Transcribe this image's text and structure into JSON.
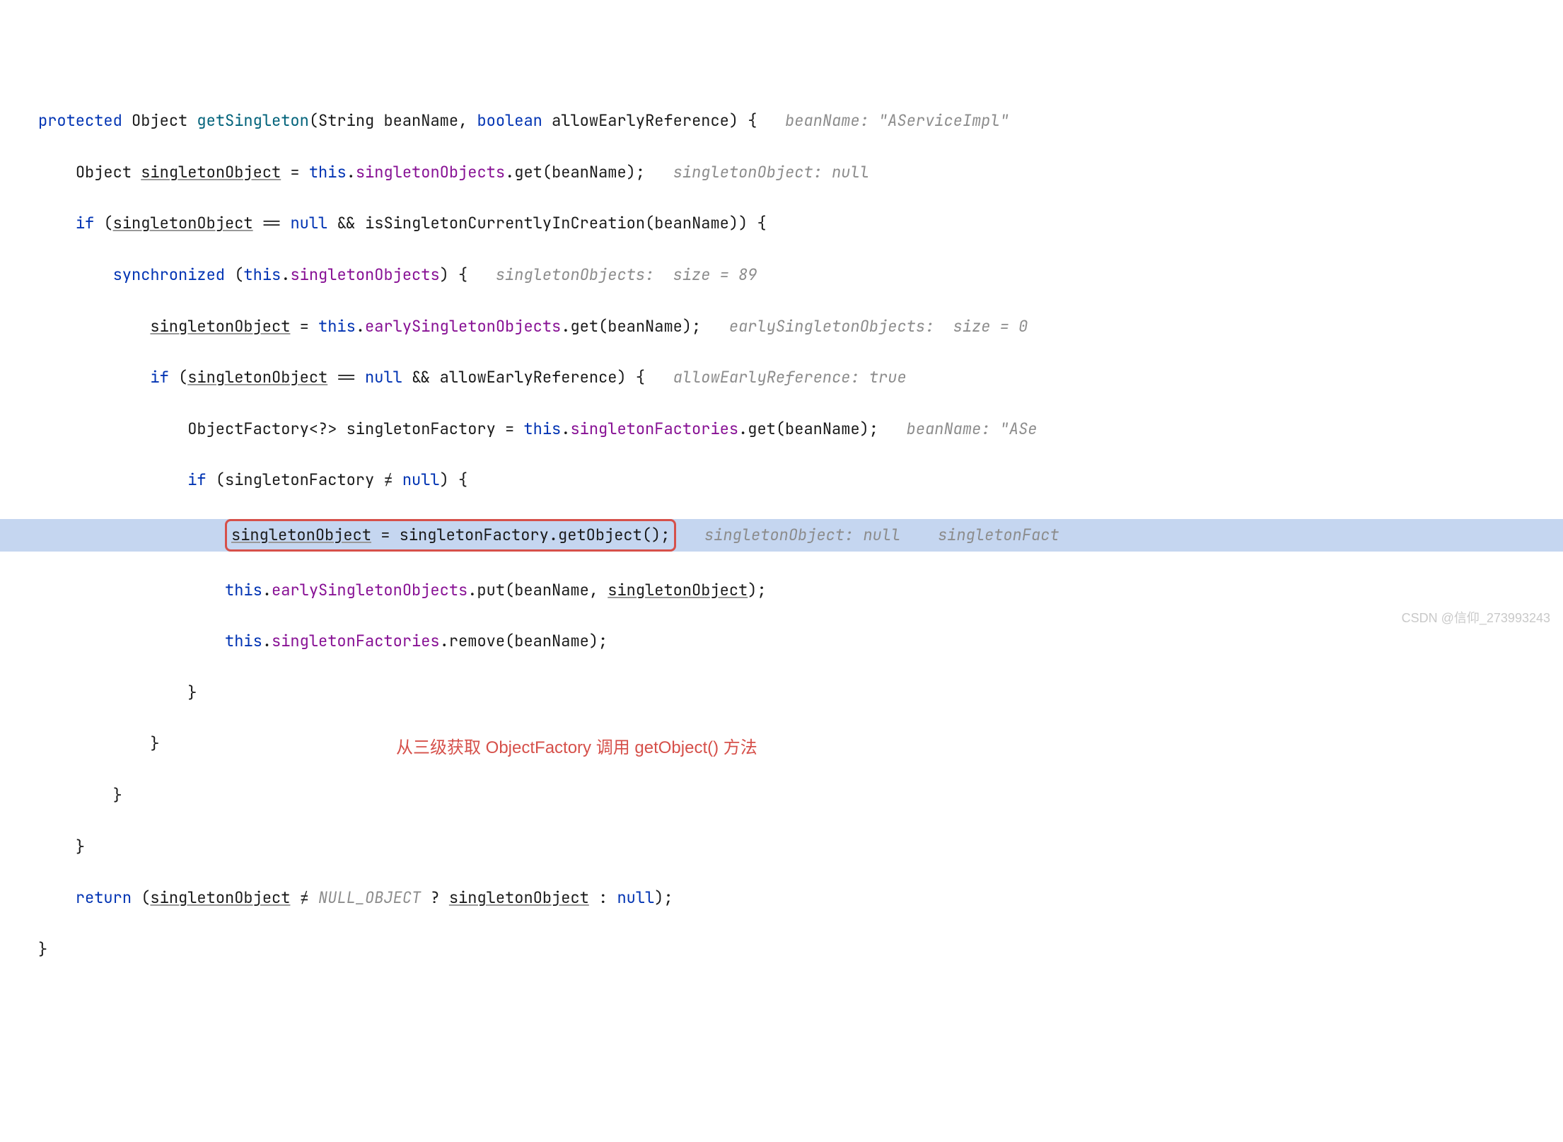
{
  "code": {
    "l1": {
      "kw_protected": "protected",
      "type_object": "Object",
      "method": "getSingleton",
      "param1_type": "String",
      "param1_name": "beanName",
      "param2_type": "boolean",
      "param2_name": "allowEarlyReference",
      "brace": ") {",
      "hint": "beanName: \"AServiceImpl\""
    },
    "l2": {
      "type_object": "Object",
      "var": "singletonObject",
      "eq": " = ",
      "this": "this",
      "field": "singletonObjects",
      "call": ".get(beanName);",
      "hint": "singletonObject: null"
    },
    "l3": {
      "kw_if": "if",
      "open": " (",
      "var": "singletonObject",
      "eqop": " == ",
      "null": "null",
      "and": " && ",
      "call": "isSingletonCurrentlyInCreation(beanName)) {"
    },
    "l4": {
      "kw_sync": "synchronized",
      "open": " (",
      "this": "this",
      "field": "singletonObjects",
      "close": ") {",
      "hint": "singletonObjects:  size = 89"
    },
    "l5": {
      "var": "singletonObject",
      "eq": " = ",
      "this": "this",
      "field": "earlySingletonObjects",
      "call": ".get(beanName);",
      "hint": "earlySingletonObjects:  size = 0"
    },
    "l6": {
      "kw_if": "if",
      "open": " (",
      "var": "singletonObject",
      "eqop": " == ",
      "null": "null",
      "and": " && ",
      "cond": "allowEarlyReference) {",
      "hint": "allowEarlyReference: true"
    },
    "l7": {
      "type": "ObjectFactory<?>",
      "var": " singletonFactory = ",
      "this": "this",
      "field": "singletonFactories",
      "call": ".get(beanName);",
      "hint": "beanName: \"ASe"
    },
    "l8": {
      "kw_if": "if",
      "open": " (singletonFactory ",
      "neq": "≠",
      "rest": " ",
      "null": "null",
      "close": ") {"
    },
    "l9": {
      "var": "singletonObject",
      "rest": " = singletonFactory.getObject();",
      "hint1": "singletonObject: null",
      "hint2": "singletonFact"
    },
    "l10": {
      "this": "this",
      "field": "earlySingletonObjects",
      "mid": ".put(beanName, ",
      "var": "singletonObject",
      "close": ");"
    },
    "l11": {
      "this": "this",
      "field": "singletonFactories",
      "call": ".remove(beanName);"
    },
    "l12": {
      "brace": "}"
    },
    "l13": {
      "brace": "}"
    },
    "l14": {
      "brace": "}"
    },
    "l15": {
      "brace": "}"
    },
    "l16": {
      "kw_return": "return",
      "open": " (",
      "var1": "singletonObject",
      "neq": " ≠ ",
      "nullobj": "NULL_OBJECT",
      "mid": " ? ",
      "var2": "singletonObject",
      "rest": " : ",
      "null": "null",
      "close": ");"
    },
    "l17": {
      "brace": "}"
    }
  },
  "annotation": "从三级获取 ObjectFactory 调用 getObject() 方法",
  "watermark": "CSDN @信仰_273993243"
}
